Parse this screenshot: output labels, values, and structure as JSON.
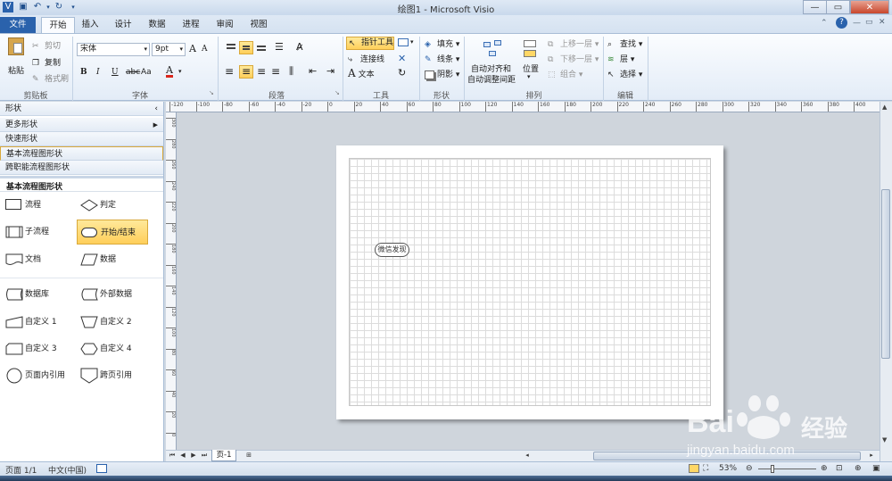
{
  "window": {
    "title": "绘图1 - Microsoft Visio",
    "help_icon": "help-icon"
  },
  "tabs": [
    "文件",
    "开始",
    "插入",
    "设计",
    "数据",
    "进程",
    "审阅",
    "视图"
  ],
  "clipboard": {
    "paste": "粘贴",
    "cut": "剪切",
    "copy": "复制",
    "format_painter": "格式刷",
    "label": "剪贴板"
  },
  "font": {
    "name": "宋体",
    "size": "9pt",
    "label": "字体",
    "bold": "B",
    "italic": "I",
    "underline": "U",
    "strike": "abc",
    "case": "Aa",
    "color": "A",
    "grow": "A",
    "shrink": "A"
  },
  "paragraph": {
    "label": "段落"
  },
  "tools": {
    "pointer": "指针工具",
    "connector": "连接线",
    "text": "文本",
    "label": "工具"
  },
  "shape_grp": {
    "fill": "填充",
    "line": "线条",
    "shadow": "阴影",
    "label": "形状"
  },
  "arrange": {
    "auto_align": "自动对齐和",
    "auto_space": "自动调整间距",
    "position": "位置",
    "bring_forward": "上移一层",
    "send_backward": "下移一层",
    "group": "组合",
    "label": "排列"
  },
  "edit": {
    "find": "查找",
    "layer": "层",
    "select": "选择",
    "label": "编辑"
  },
  "pane": {
    "header": "形状",
    "more_shapes": "更多形状",
    "quick_shapes": "快速形状",
    "basic_flow": "基本流程图形状",
    "cross_func": "跨职能流程图形状",
    "stencil_title": "基本流程图形状",
    "stencils": [
      {
        "label": "流程",
        "icon": "process-shape-icon"
      },
      {
        "label": "判定",
        "icon": "decision-shape-icon"
      },
      {
        "label": "子流程",
        "icon": "subprocess-shape-icon"
      },
      {
        "label": "开始/结束",
        "icon": "terminator-shape-icon"
      },
      {
        "label": "文档",
        "icon": "document-shape-icon"
      },
      {
        "label": "数据",
        "icon": "data-shape-icon"
      },
      {
        "label": "数据库",
        "icon": "database-shape-icon"
      },
      {
        "label": "外部数据",
        "icon": "external-data-shape-icon"
      },
      {
        "label": "自定义 1",
        "icon": "custom1-shape-icon"
      },
      {
        "label": "自定义 2",
        "icon": "custom2-shape-icon"
      },
      {
        "label": "自定义 3",
        "icon": "custom3-shape-icon"
      },
      {
        "label": "自定义 4",
        "icon": "custom4-shape-icon"
      },
      {
        "label": "页面内引用",
        "icon": "onpage-ref-shape-icon"
      },
      {
        "label": "跨页引用",
        "icon": "offpage-ref-shape-icon"
      }
    ]
  },
  "ruler": {
    "h_ticks": [
      "-120",
      "-100",
      "-80",
      "-60",
      "-40",
      "-20",
      "0",
      "20",
      "40",
      "60",
      "80",
      "100",
      "120",
      "140",
      "160",
      "180",
      "200",
      "220",
      "240",
      "260",
      "280",
      "300",
      "320",
      "340",
      "360",
      "380",
      "400"
    ],
    "v_ticks": [
      "300",
      "280",
      "260",
      "240",
      "220",
      "200",
      "180",
      "160",
      "140",
      "120",
      "100",
      "80",
      "60",
      "40",
      "20",
      "0"
    ]
  },
  "canvas": {
    "shape_text": "微信发现"
  },
  "pages": {
    "tab": "页-1"
  },
  "status": {
    "page": "页面 1/1",
    "lang": "中文(中国)",
    "zoom": "53%"
  },
  "watermark": {
    "brand": "Bai",
    "brand2": "经验",
    "url": "jingyan.baidu.com"
  }
}
